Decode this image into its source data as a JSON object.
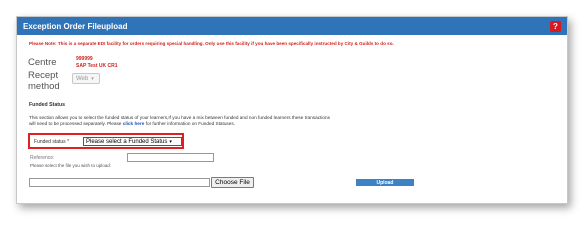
{
  "header": {
    "title": "Exception Order Fileupload",
    "help_icon": "question-icon",
    "help_glyph": "?"
  },
  "note": "Please Note: This is a separate EDI facility for orders requiring special handling. Only use this facility if you have been specifically instructed by City & Guilds to do so.",
  "centre": {
    "label": "Centre",
    "number": "999999",
    "name": "SAP Test UK CR1"
  },
  "receipt": {
    "label_line1": "Recept",
    "label_line2": "method",
    "selected": "Web",
    "chevron": "▾"
  },
  "funded_section": {
    "heading": "Funded Status",
    "text_line1": "This section allows you to select the funded status of your learners,If you have a mix between funded and non funded learners these transactions",
    "text_line2_prefix": "will need to be processed separately. Please ",
    "link": "click here",
    "text_line2_suffix": " for further information on Funded Statuses.",
    "label": "Funded status *",
    "selected": "Please select a Funded Status",
    "chevron": "▾",
    "highlight_color": "#e02020"
  },
  "reference": {
    "label": "Reference:",
    "value": ""
  },
  "file": {
    "label": "Please select the file you wish to upload:",
    "value": "",
    "choose_label": "Choose File",
    "upload_label": "Upload"
  },
  "colors": {
    "header_bg": "#2f74b8",
    "note_red": "#d21f1f",
    "upload_bg": "#3c82c4"
  }
}
